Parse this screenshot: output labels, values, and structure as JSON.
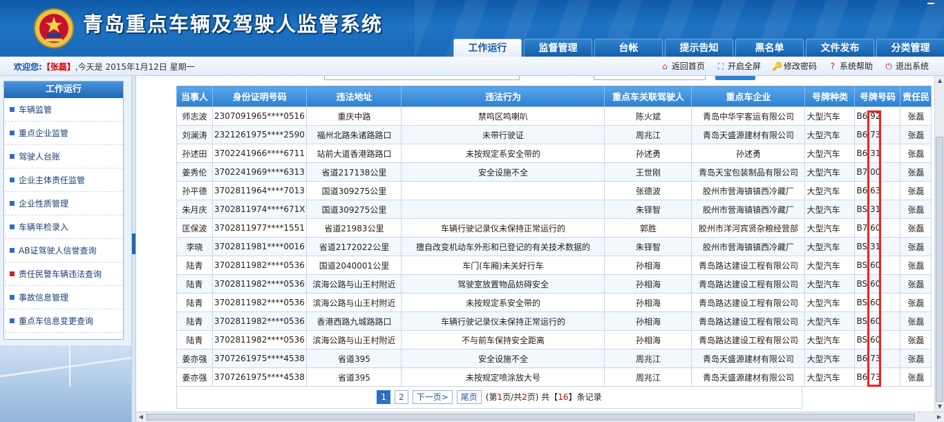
{
  "header": {
    "title": "青岛重点车辆及驾驶人监管系统",
    "nav_tabs": [
      "工作运行",
      "监督管理",
      "台帐",
      "提示告知",
      "黑名单",
      "文件发布",
      "分类管理"
    ]
  },
  "infobar": {
    "welcome_label": "欢迎您:",
    "user": "【张磊】",
    "date_text": ",今天是 2015年1月12日 星期一",
    "links": [
      {
        "label": "返回首页",
        "icon": "home-icon"
      },
      {
        "label": "开启全屏",
        "icon": "fullscreen-icon"
      },
      {
        "label": "修改密码",
        "icon": "key-icon"
      },
      {
        "label": "系统帮助",
        "icon": "help-icon"
      },
      {
        "label": "退出系统",
        "icon": "logout-icon"
      }
    ]
  },
  "sidebar": {
    "title": "工作运行",
    "items": [
      "车辆监管",
      "重点企业监管",
      "驾驶人台账",
      "企业主体责任监管",
      "企业性质管理",
      "车辆年检录入",
      "AB证驾驶人信誉查询",
      "责任民警车辆违法查询",
      "事故信息管理",
      "重点车信息变更查询"
    ],
    "active_index": 7
  },
  "table": {
    "columns": [
      "当事人",
      "身份证明号码",
      "违法地址",
      "违法行为",
      "重点车关联驾驶人",
      "重点车企业",
      "号牌种类",
      "号牌号码",
      "责任民"
    ],
    "rows": [
      [
        "师志波",
        "2307091965****0516",
        "重庆中路",
        "禁鸣区鸣喇叭",
        "陈火斌",
        "青岛中华宇客运有限公司",
        "大型汽车",
        "B6  92",
        "张磊"
      ],
      [
        "刘澜涛",
        "2321261975****2590",
        "福州北路朱诸路路口",
        "未带行驶证",
        "周兆江",
        "青岛天盛源建材有限公司",
        "大型汽车",
        "B6  73",
        "张磊"
      ],
      [
        "孙述田",
        "3702241966****6711",
        "站前大道香港路路口",
        "未按规定系安全带的",
        "孙述勇",
        "孙述勇",
        "大型汽车",
        "B6  31",
        "张磊"
      ],
      [
        "姜秀伦",
        "3702241969****6313",
        "省道217138公里",
        "安全设施不全",
        "王世刚",
        "青岛天宝包装制品有限公司",
        "大型汽车",
        "B7  00",
        "张磊"
      ],
      [
        "孙平德",
        "3702811964****7013",
        "国道309275公里",
        "",
        "张德波",
        "胶州市营海镇镇西冷藏厂",
        "大型汽车",
        "B6  63",
        "张磊"
      ],
      [
        "朱月庆",
        "3702811974****671X",
        "国道309275公里",
        "",
        "朱铎智",
        "胶州市营海镇镇西冷藏厂",
        "大型汽车",
        "BS  31",
        "张磊"
      ],
      [
        "匡保波",
        "3702811977****1551",
        "省道21983公里",
        "车辆行驶记录仪未保持正常运行的",
        "郭胜",
        "胶州市洋河宾贤杂粮经营部",
        "大型汽车",
        "B7  60",
        "张磊"
      ],
      [
        "李晓",
        "3702811981****0016",
        "省道2172022公里",
        "擅自改变机动车外形和已登记的有关技术数据的",
        "朱铎智",
        "胶州市营海镇镇西冷藏厂",
        "大型汽车",
        "BS  31",
        "张磊"
      ],
      [
        "陆青",
        "3702811982****0536",
        "国道2040001公里",
        "车门(车厢)未关好行车",
        "孙相海",
        "青岛路达建设工程有限公司",
        "大型汽车",
        "BS  60",
        "张磊"
      ],
      [
        "陆青",
        "3702811982****0536",
        "滨海公路与山王村附近",
        "驾驶室放置物品妨碍安全",
        "孙相海",
        "青岛路达建设工程有限公司",
        "大型汽车",
        "BS  60",
        "张磊"
      ],
      [
        "陆青",
        "3702811982****0536",
        "滨海公路与山王村附近",
        "未按规定系安全带的",
        "孙相海",
        "青岛路达建设工程有限公司",
        "大型汽车",
        "BS  60",
        "张磊"
      ],
      [
        "陆青",
        "3702811982****0536",
        "香港西路九城路路口",
        "车辆行驶记录仪未保持正常运行的",
        "孙相海",
        "青岛路达建设工程有限公司",
        "大型汽车",
        "BS  60",
        "张磊"
      ],
      [
        "陆青",
        "3702811982****0536",
        "滨海公路与山王村附近",
        "不与前车保持安全距离",
        "孙相海",
        "青岛路达建设工程有限公司",
        "大型汽车",
        "BS  60",
        "张磊"
      ],
      [
        "姜亦强",
        "3707261975****4538",
        "省道395",
        "安全设施不全",
        "周兆江",
        "青岛天盛源建材有限公司",
        "大型汽车",
        "B6  73",
        "张磊"
      ],
      [
        "姜亦强",
        "3707261975****4538",
        "省道395",
        "未按规定喷涂放大号",
        "周兆江",
        "青岛天盛源建材有限公司",
        "大型汽车",
        "B6  73",
        "张磊"
      ]
    ]
  },
  "pager": {
    "pages": [
      "1",
      "2"
    ],
    "current": "1",
    "next": "下一页>",
    "last": "尾页",
    "info_prefix": "(第",
    "info_current": "1",
    "info_mid": "页/共",
    "info_total": "2",
    "info_suffix": "页) 共【",
    "info_count": "16",
    "info_end": "】条记录"
  }
}
